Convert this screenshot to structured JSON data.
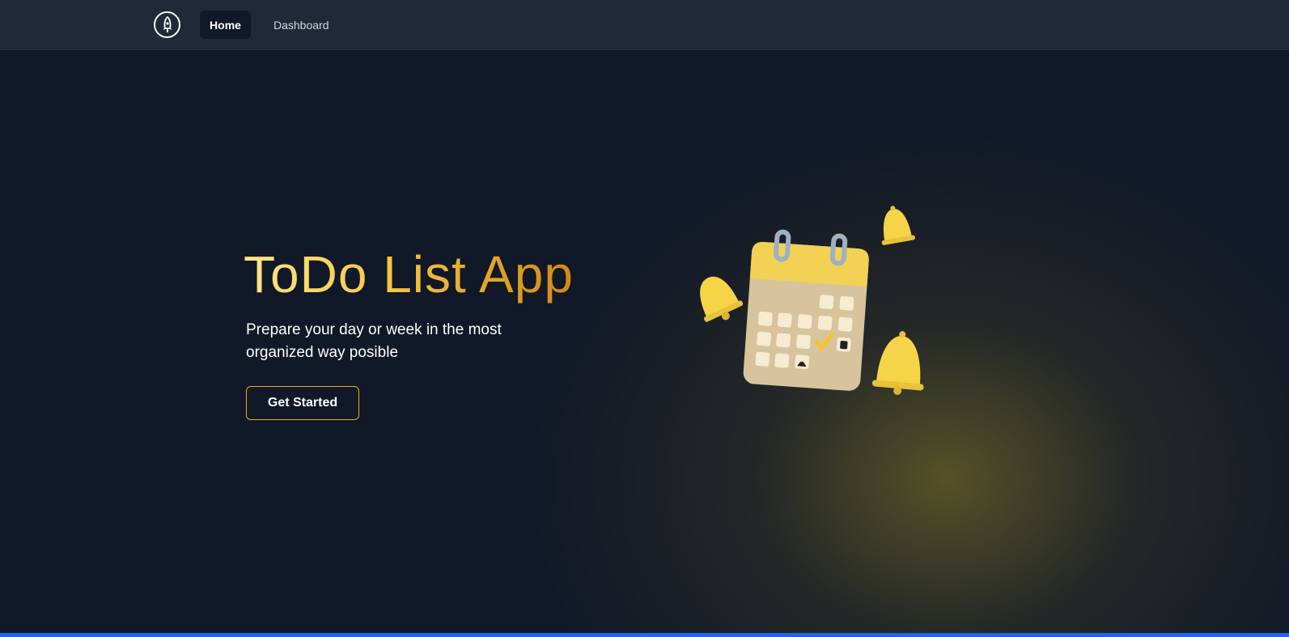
{
  "nav": {
    "logo_icon": "rocket-icon",
    "home_label": "Home",
    "dashboard_label": "Dashboard"
  },
  "hero": {
    "title": "ToDo List App",
    "subtitle": "Prepare your day or week in the most organized way posible",
    "cta_label": "Get Started",
    "illustration": "calendar-with-bells-illustration"
  },
  "colors": {
    "nav_bg": "#1f2937",
    "page_bg": "#111827",
    "accent": "#eab308",
    "title_gradient_start": "#fde68a",
    "title_gradient_end": "#d08a12",
    "bottom_bar": "#2563eb"
  }
}
